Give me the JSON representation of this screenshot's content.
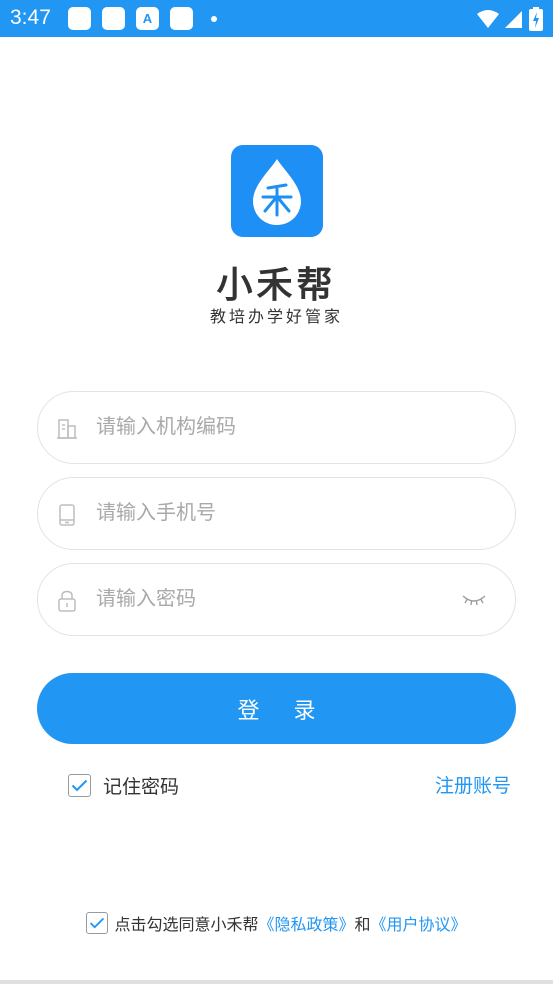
{
  "status_bar": {
    "time": "3:47"
  },
  "brand": {
    "name": "小禾帮",
    "slogan": "教培办学好管家"
  },
  "form": {
    "org_code_placeholder": "请输入机构编码",
    "phone_placeholder": "请输入手机号",
    "password_placeholder": "请输入密码"
  },
  "login_button": "登 录",
  "remember_label": "记住密码",
  "register_link": "注册账号",
  "agreement": {
    "prefix": "点击勾选同意小禾帮",
    "privacy_link": "《隐私政策》",
    "and": "和",
    "user_agreement_link": "《用户协议》"
  },
  "colors": {
    "accent": "#2196F3"
  },
  "icons": [
    "building-icon",
    "phone-icon",
    "lock-icon",
    "eye-closed-icon",
    "check-icon",
    "wifi-icon",
    "signal-icon",
    "battery-icon"
  ]
}
